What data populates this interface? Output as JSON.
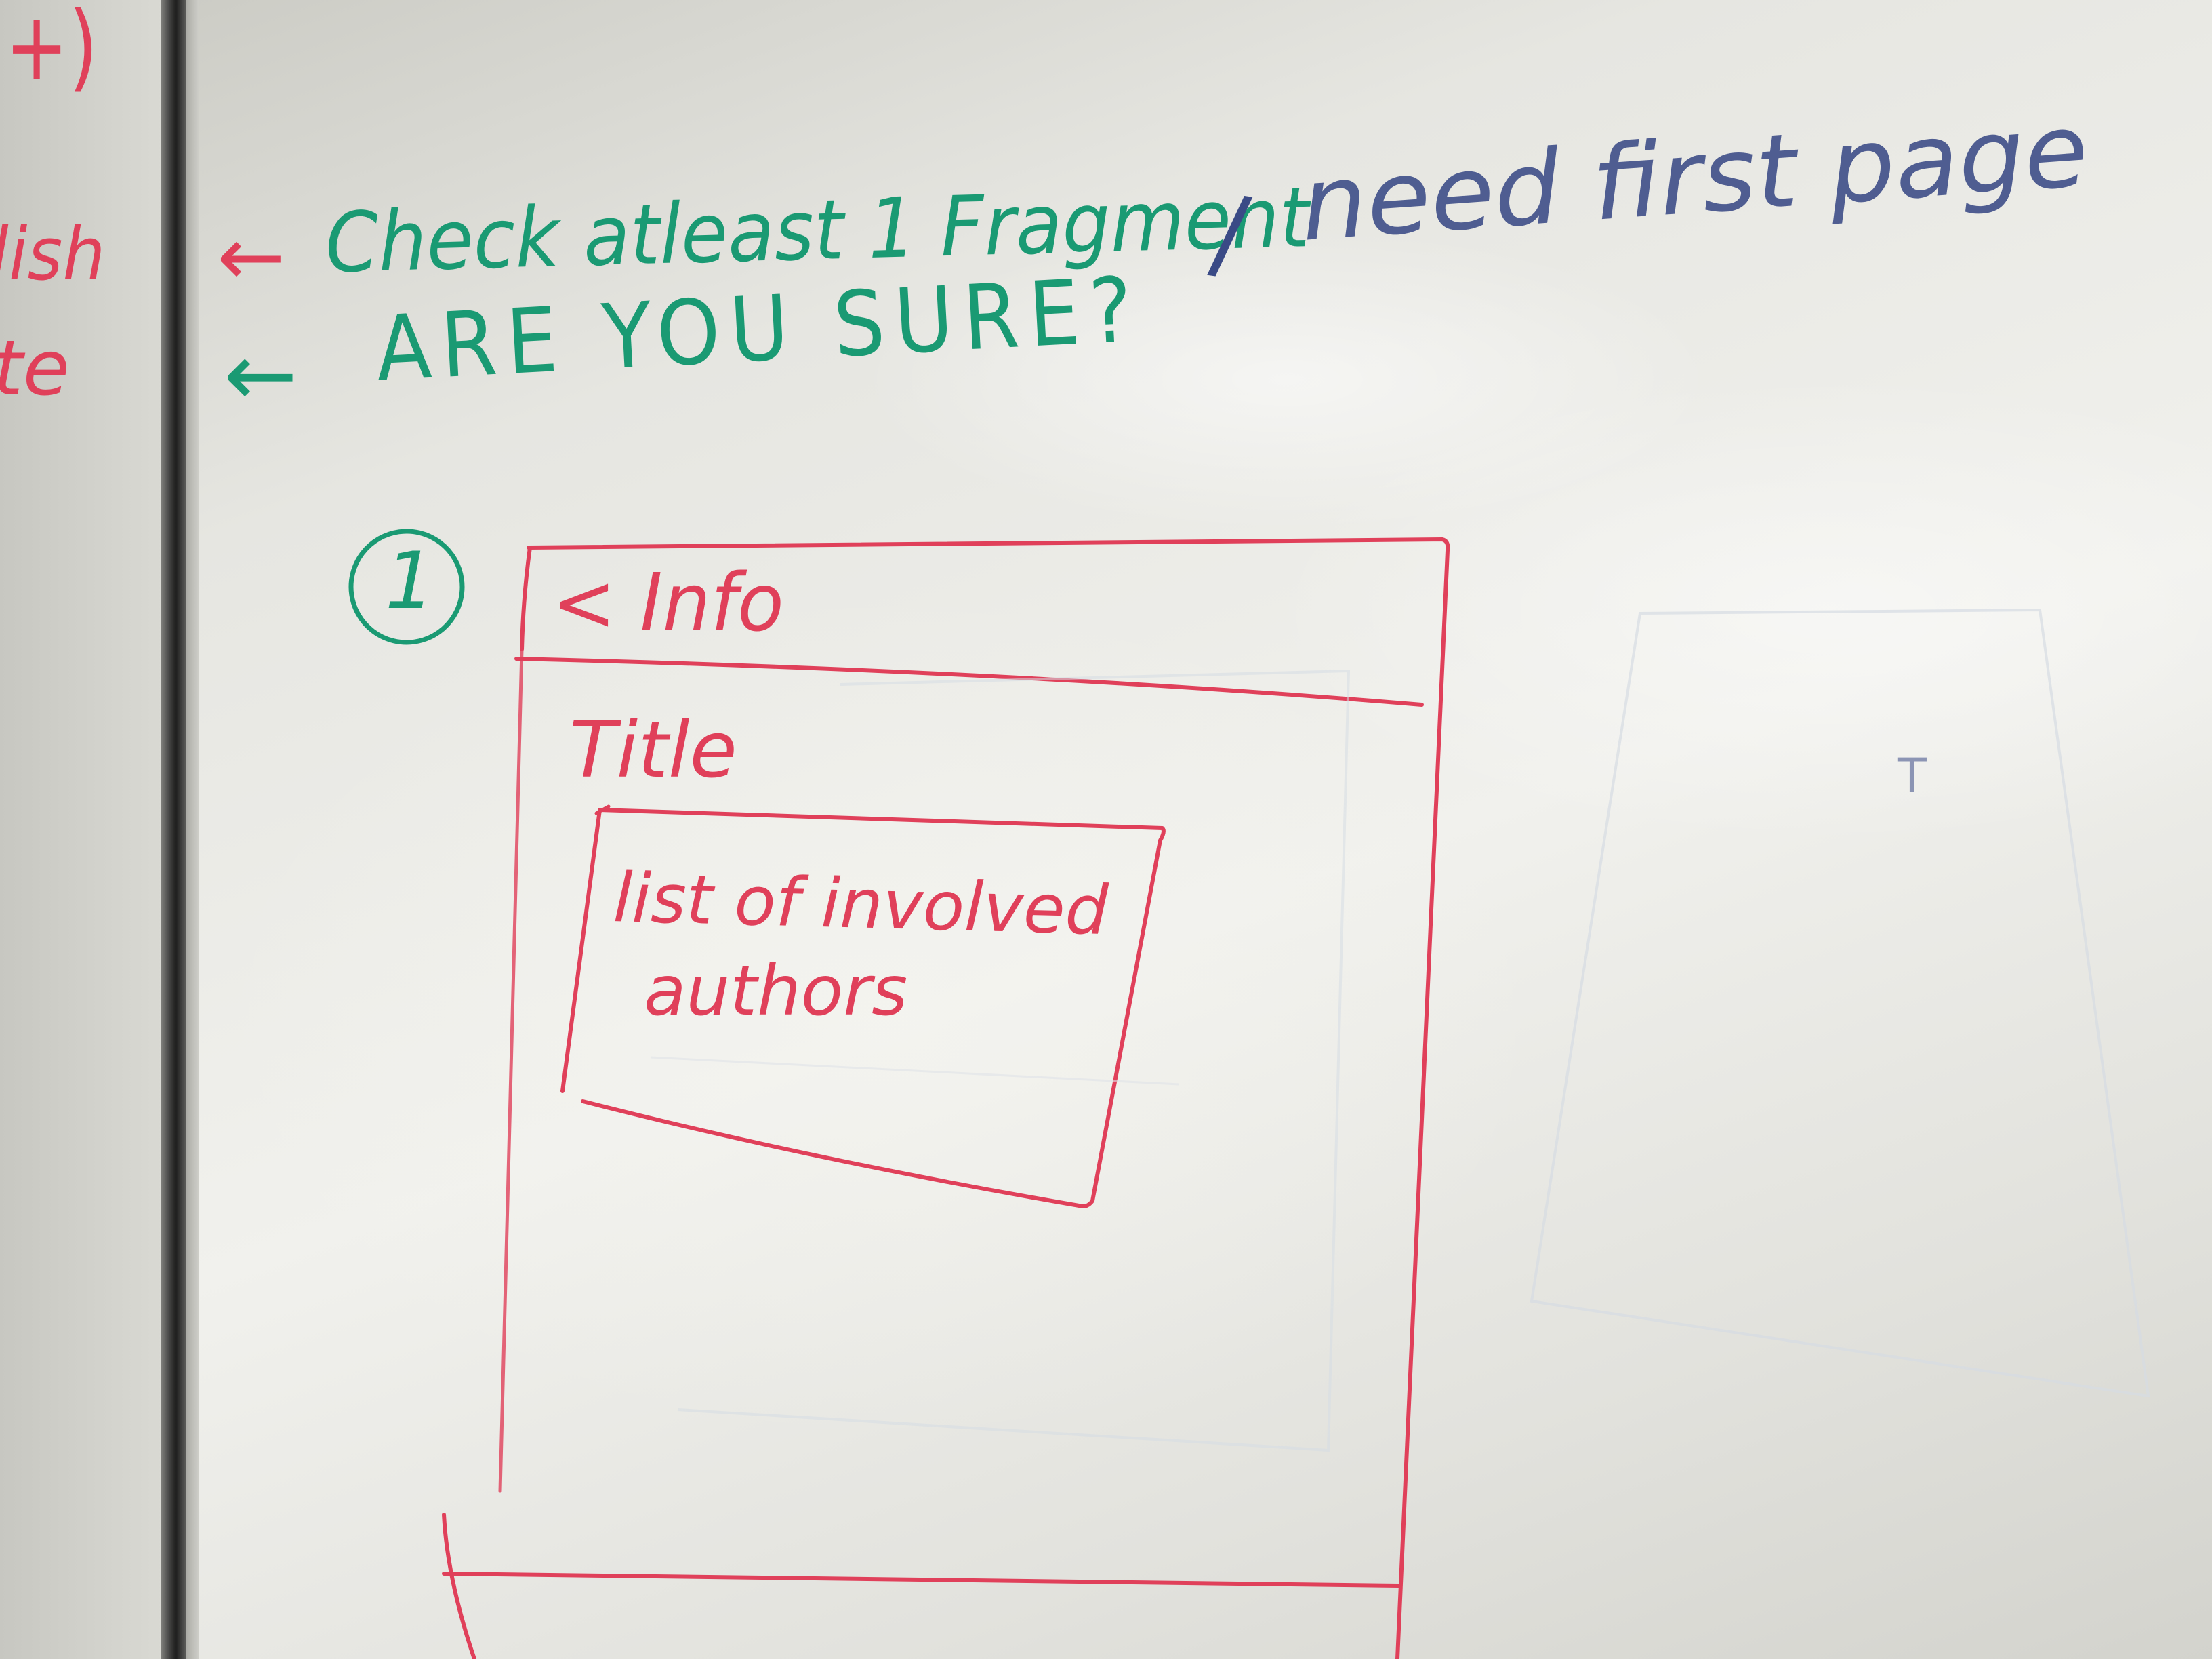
{
  "left_fragments": {
    "top": "+)",
    "line1": "lish",
    "line2": "te"
  },
  "notes": {
    "arrow": "←",
    "check_text": "Check atleast 1 Fragment",
    "slash": "/",
    "need_text": "need first page",
    "confirm_text": "ARE YOU SURE?"
  },
  "step_marker": "1",
  "mockup": {
    "back_label": "< Info",
    "title_label": "Title",
    "list_line1": "list of involved",
    "list_line2": "authors"
  },
  "faint_mark": "T",
  "colors": {
    "green_marker": "#1a9a73",
    "red_marker": "#e0405a",
    "navy_marker": "#3a4a86",
    "board": "#eeeeea"
  }
}
